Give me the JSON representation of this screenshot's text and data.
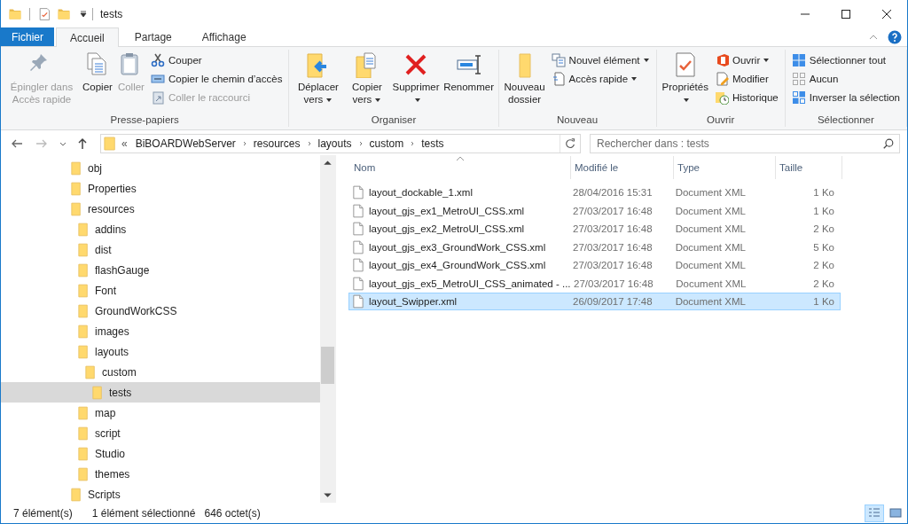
{
  "window": {
    "title": "tests"
  },
  "tabs": [
    {
      "label": "Fichier",
      "kind": "file",
      "selected": false
    },
    {
      "label": "Accueil",
      "kind": "tab",
      "selected": true
    },
    {
      "label": "Partage",
      "kind": "tab",
      "selected": false
    },
    {
      "label": "Affichage",
      "kind": "tab",
      "selected": false
    }
  ],
  "ribbon": [
    {
      "label": "Presse-papiers",
      "columns": [
        {
          "kind": "large",
          "items": [
            {
              "label": "Épingler dans Accès rapide",
              "disabled": true,
              "has_menu": false
            }
          ]
        },
        {
          "kind": "large",
          "items": [
            {
              "label": "Copier",
              "disabled": false,
              "has_menu": false
            }
          ]
        },
        {
          "kind": "large",
          "items": [
            {
              "label": "Coller",
              "disabled": true,
              "has_menu": false
            }
          ]
        },
        {
          "kind": "stack",
          "items": [
            {
              "label": "Couper",
              "disabled": false,
              "has_menu": false
            },
            {
              "label": "Copier le chemin d’accès",
              "disabled": false,
              "has_menu": false
            },
            {
              "label": "Coller le raccourci",
              "disabled": true,
              "has_menu": false
            }
          ]
        }
      ]
    },
    {
      "label": "Organiser",
      "columns": [
        {
          "kind": "large",
          "items": [
            {
              "label": "Déplacer vers",
              "disabled": false,
              "has_menu": true
            }
          ]
        },
        {
          "kind": "large",
          "items": [
            {
              "label": "Copier vers",
              "disabled": false,
              "has_menu": true
            }
          ]
        },
        {
          "kind": "large",
          "items": [
            {
              "label": "Supprimer",
              "disabled": false,
              "has_menu": true
            }
          ]
        },
        {
          "kind": "large",
          "items": [
            {
              "label": "Renommer",
              "disabled": false,
              "has_menu": false
            }
          ]
        }
      ]
    },
    {
      "label": "Nouveau",
      "columns": [
        {
          "kind": "large",
          "items": [
            {
              "label": "Nouveau dossier",
              "disabled": false,
              "has_menu": false
            }
          ]
        },
        {
          "kind": "stack",
          "items": [
            {
              "label": "Nouvel élément",
              "disabled": false,
              "has_menu": true
            },
            {
              "label": "Accès rapide",
              "disabled": false,
              "has_menu": true
            }
          ]
        }
      ]
    },
    {
      "label": "Ouvrir",
      "columns": [
        {
          "kind": "large",
          "items": [
            {
              "label": "Propriétés",
              "disabled": false,
              "has_menu": true
            }
          ]
        },
        {
          "kind": "stack",
          "items": [
            {
              "label": "Ouvrir",
              "disabled": false,
              "has_menu": true
            },
            {
              "label": "Modifier",
              "disabled": false,
              "has_menu": false
            },
            {
              "label": "Historique",
              "disabled": false,
              "has_menu": false
            }
          ]
        }
      ]
    },
    {
      "label": "Sélectionner",
      "columns": [
        {
          "kind": "stack",
          "items": [
            {
              "label": "Sélectionner tout",
              "disabled": false,
              "has_menu": false
            },
            {
              "label": "Aucun",
              "disabled": false,
              "has_menu": false
            },
            {
              "label": "Inverser la sélection",
              "disabled": false,
              "has_menu": false
            }
          ]
        }
      ]
    }
  ],
  "address": {
    "overflow": "«",
    "crumbs": [
      "BiBOARDWebServer",
      "resources",
      "layouts",
      "custom",
      "tests"
    ]
  },
  "search": {
    "placeholder": "Rechercher dans : tests"
  },
  "tree": [
    {
      "label": "obj",
      "selected": false
    },
    {
      "label": "Properties",
      "selected": false
    },
    {
      "label": "resources",
      "selected": false,
      "children": [
        {
          "label": "addins",
          "selected": false
        },
        {
          "label": "dist",
          "selected": false
        },
        {
          "label": "flashGauge",
          "selected": false
        },
        {
          "label": "Font",
          "selected": false
        },
        {
          "label": "GroundWorkCSS",
          "selected": false
        },
        {
          "label": "images",
          "selected": false
        },
        {
          "label": "layouts",
          "selected": false,
          "children": [
            {
              "label": "custom",
              "selected": false,
              "children": [
                {
                  "label": "tests",
                  "selected": true
                }
              ]
            }
          ]
        },
        {
          "label": "map",
          "selected": false
        },
        {
          "label": "script",
          "selected": false
        },
        {
          "label": "Studio",
          "selected": false
        },
        {
          "label": "themes",
          "selected": false
        }
      ]
    },
    {
      "label": "Scripts",
      "selected": false
    }
  ],
  "table": {
    "columns": [
      "Nom",
      "Modifié le",
      "Type",
      "Taille"
    ],
    "rows": [
      {
        "name": "layout_dockable_1.xml",
        "modified": "28/04/2016 15:31",
        "type": "Document XML",
        "size": "1 Ko",
        "selected": false
      },
      {
        "name": "layout_gjs_ex1_MetroUI_CSS.xml",
        "modified": "27/03/2017 16:48",
        "type": "Document XML",
        "size": "1 Ko",
        "selected": false
      },
      {
        "name": "layout_gjs_ex2_MetroUI_CSS.xml",
        "modified": "27/03/2017 16:48",
        "type": "Document XML",
        "size": "2 Ko",
        "selected": false
      },
      {
        "name": "layout_gjs_ex3_GroundWork_CSS.xml",
        "modified": "27/03/2017 16:48",
        "type": "Document XML",
        "size": "5 Ko",
        "selected": false
      },
      {
        "name": "layout_gjs_ex4_GroundWork_CSS.xml",
        "modified": "27/03/2017 16:48",
        "type": "Document XML",
        "size": "2 Ko",
        "selected": false
      },
      {
        "name": "layout_gjs_ex5_MetroUI_CSS_animated - ...",
        "modified": "27/03/2017 16:48",
        "type": "Document XML",
        "size": "2 Ko",
        "selected": false
      },
      {
        "name": "layout_Swipper.xml",
        "modified": "26/09/2017 17:48",
        "type": "Document XML",
        "size": "1 Ko",
        "selected": true
      }
    ]
  },
  "status_bar": {
    "count": "7 élément(s)",
    "selection": "1 élément sélectionné",
    "size": "646 octet(s)",
    "views": [
      {
        "selected": true
      },
      {
        "selected": false
      }
    ]
  }
}
